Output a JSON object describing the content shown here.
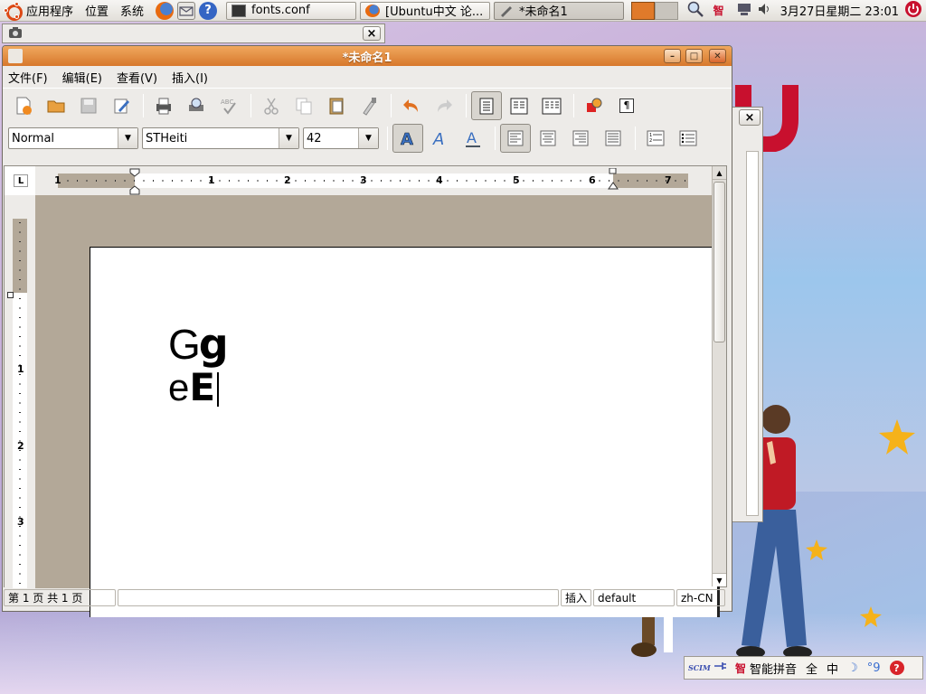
{
  "topbar": {
    "menus": [
      "应用程序",
      "位置",
      "系统"
    ],
    "tasks": [
      {
        "label": "fonts.conf",
        "icon": "terminal-icon"
      },
      {
        "label": "[Ubuntu中文 论...",
        "icon": "firefox-icon"
      },
      {
        "label": "*未命名1",
        "icon": "writer-icon"
      }
    ],
    "clock": "3月27日星期二 23:01",
    "tray_zhi": "智"
  },
  "screenshot_bar": {
    "close": "×"
  },
  "writer": {
    "title": "*未命名1",
    "menus": [
      "文件(F)",
      "编辑(E)",
      "查看(V)",
      "插入(I)"
    ],
    "style": "Normal",
    "font": "STHeiti",
    "size": "42",
    "paragraph_mark": "¶",
    "ruler_h": [
      "1",
      "1",
      "2",
      "3",
      "4",
      "5",
      "6",
      "7"
    ],
    "ruler_v": [
      "1",
      "2",
      "3"
    ],
    "doc_line1": [
      "G",
      "g"
    ],
    "doc_line2": [
      "e",
      "E"
    ],
    "status": {
      "page": "第 1 页 共 1 页",
      "mode": "插入",
      "style": "default",
      "lang": "zh-CN"
    }
  },
  "ime": {
    "logo": "SCIM",
    "name": "智能拼音",
    "full": "全",
    "zh": "中",
    "moon": "☽",
    "punct": "°9",
    "zhi": "智"
  },
  "colors": {
    "accent": "#d7782c",
    "ubuntu": "#dd4814",
    "star": "#f5b21a",
    "logo_red": "#c8102e"
  }
}
